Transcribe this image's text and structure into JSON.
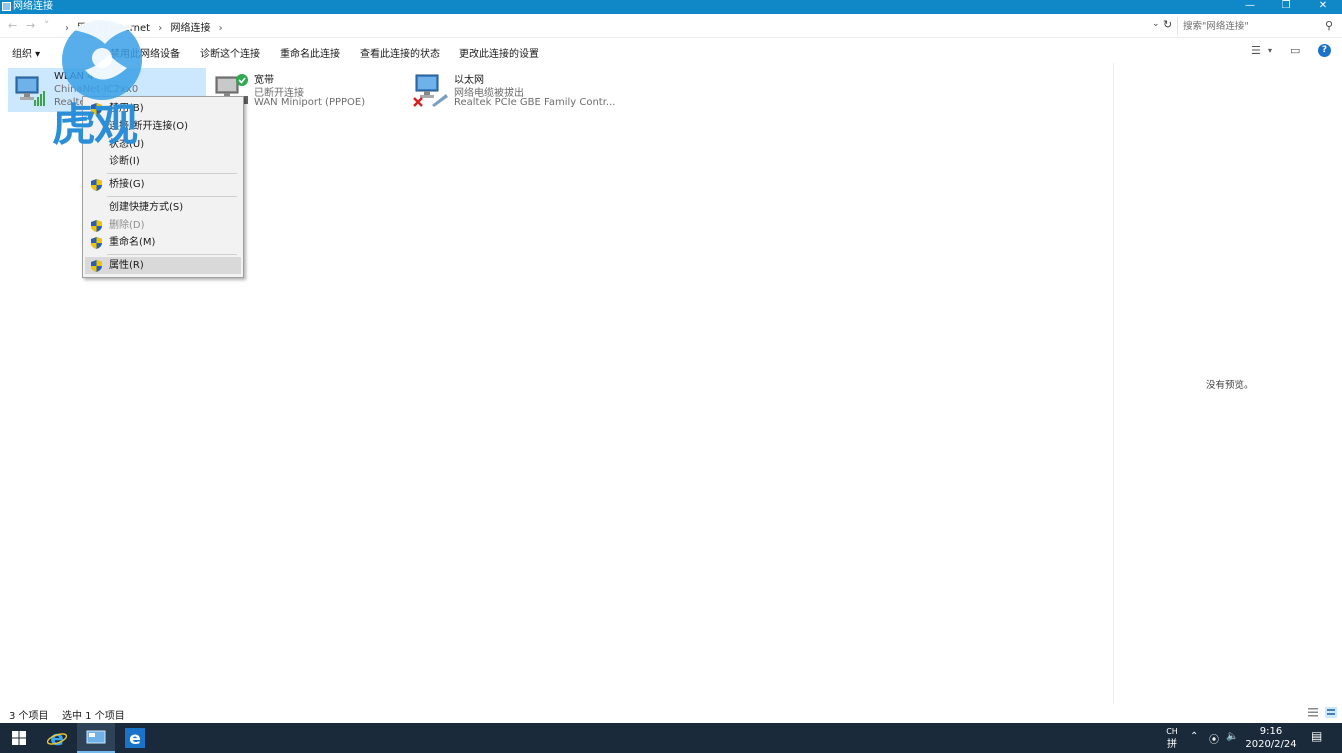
{
  "window": {
    "title": "网络连接"
  },
  "address": {
    "crumbs": [
      "网络和 Internet",
      "网络连接"
    ],
    "search_placeholder": "搜索\"网络连接\""
  },
  "toolbar": {
    "organize": "组织 ▾",
    "disable_device": "禁用此网络设备",
    "diagnose": "诊断这个连接",
    "rename": "重命名此连接",
    "view_status": "查看此连接的状态",
    "change_settings": "更改此连接的设置"
  },
  "items": [
    {
      "name": "WLAN 4",
      "status": "ChinaNet-IC2xx0",
      "device": "Realtek",
      "icon": "wireless-network-icon",
      "selected": true
    },
    {
      "name": "宽带",
      "status": "已断开连接",
      "device": "WAN Miniport (PPPOE)",
      "icon": "broadband-icon",
      "selected": false
    },
    {
      "name": "以太网",
      "status": "网络电缆被拔出",
      "device": "Realtek PCIe GBE Family Contr...",
      "icon": "ethernet-icon",
      "selected": false
    }
  ],
  "context_menu": {
    "items": [
      {
        "label": "禁用(B)",
        "shield": true,
        "disabled": false
      },
      {
        "label": "连接/断开连接(O)",
        "shield": false,
        "disabled": false
      },
      {
        "label": "状态(U)",
        "shield": false,
        "disabled": false
      },
      {
        "label": "诊断(I)",
        "shield": false,
        "disabled": false
      },
      {
        "label": "桥接(G)",
        "shield": true,
        "disabled": false
      },
      {
        "label": "创建快捷方式(S)",
        "shield": false,
        "disabled": false
      },
      {
        "label": "删除(D)",
        "shield": true,
        "disabled": true
      },
      {
        "label": "重命名(M)",
        "shield": true,
        "disabled": false
      },
      {
        "label": "属性(R)",
        "shield": true,
        "disabled": false,
        "hover": true
      }
    ]
  },
  "preview": {
    "text": "没有预览。"
  },
  "status": {
    "item_count": "3 个项目",
    "selected_count": "选中 1 个项目"
  },
  "watermark": {
    "text": "虎观"
  },
  "taskbar": {
    "time": "9:16",
    "date": "2020/2/24",
    "ime_top": "CH",
    "ime_bottom": "拼"
  },
  "colors": {
    "accent": "#1088c8",
    "selection": "#cce8ff",
    "taskbar": "#1a2a3a"
  }
}
